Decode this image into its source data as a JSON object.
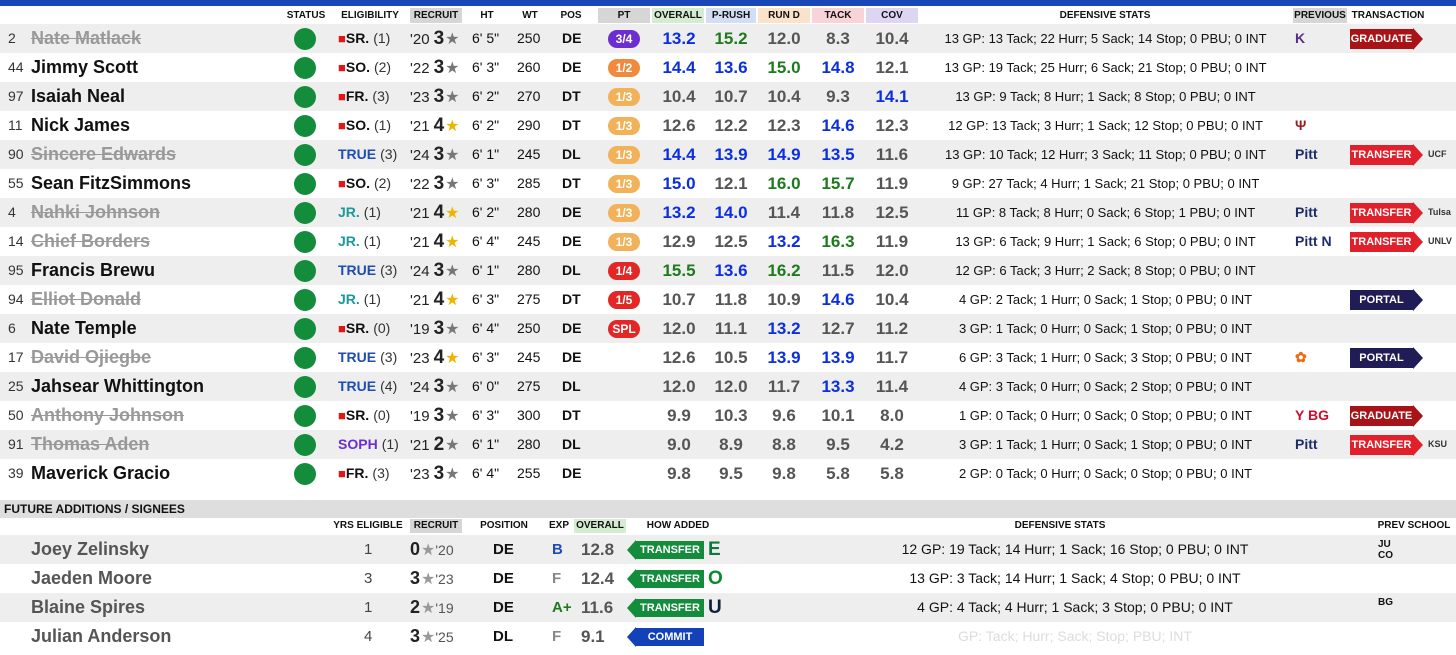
{
  "headers": {
    "status": "STATUS",
    "eligibility": "ELIGIBILITY",
    "recruit": "RECRUIT",
    "ht": "HT",
    "wt": "WT",
    "pos": "POS",
    "pt": "PT",
    "overall": "OVERALL",
    "prush": "P-RUSH",
    "rund": "RUN D",
    "tack": "TACK",
    "cov": "COV",
    "defstats": "DEFENSIVE STATS",
    "previous": "PREVIOUS",
    "transaction": "TRANSACTION"
  },
  "roster": [
    {
      "num": "2",
      "name": "Nate Matlack",
      "gone": true,
      "redshirt": true,
      "elig": "SR.",
      "eligcolor": "#111",
      "yrs": "(1)",
      "year": "'20",
      "stars": "3",
      "starcolor": "#777",
      "ht": "6' 5\"",
      "wt": "250",
      "pos": "DE",
      "pt": "3/4",
      "ptcolor": "#6b2fd1",
      "ovr": "13.2",
      "ovrc": "blu",
      "pr": "15.2",
      "prc": "grn",
      "rd": "12.0",
      "rdc": "gry",
      "tk": "8.3",
      "tkc": "gry",
      "cv": "10.4",
      "cvc": "gry",
      "stats": "13 GP: 13 Tack; 22 Hurr; 5 Sack; 14 Stop; 0 PBU; 0 INT",
      "prev": "K",
      "prevcolor": "#5a2d8a",
      "tx": "GRADUATE",
      "txc": "drk",
      "dest": ""
    },
    {
      "num": "44",
      "name": "Jimmy Scott",
      "gone": false,
      "redshirt": true,
      "elig": "SO.",
      "eligcolor": "#111",
      "yrs": "(2)",
      "year": "'22",
      "stars": "3",
      "starcolor": "#777",
      "ht": "6' 3\"",
      "wt": "260",
      "pos": "DE",
      "pt": "1/2",
      "ptcolor": "#f08a3c",
      "ovr": "14.4",
      "ovrc": "blu",
      "pr": "13.6",
      "prc": "blu",
      "rd": "15.0",
      "rdc": "grn",
      "tk": "14.8",
      "tkc": "blu",
      "cv": "12.1",
      "cvc": "gry",
      "stats": "13 GP: 19 Tack; 25 Hurr; 6 Sack; 21 Stop; 0 PBU; 0 INT",
      "prev": "",
      "prevcolor": "#000",
      "tx": "",
      "txc": "",
      "dest": ""
    },
    {
      "num": "97",
      "name": "Isaiah Neal",
      "gone": false,
      "redshirt": true,
      "elig": "FR.",
      "eligcolor": "#111",
      "yrs": "(3)",
      "year": "'23",
      "stars": "3",
      "starcolor": "#777",
      "ht": "6' 2\"",
      "wt": "270",
      "pos": "DT",
      "pt": "1/3",
      "ptcolor": "#f2b25a",
      "ovr": "10.4",
      "ovrc": "gry",
      "pr": "10.7",
      "prc": "gry",
      "rd": "10.4",
      "rdc": "gry",
      "tk": "9.3",
      "tkc": "gry",
      "cv": "14.1",
      "cvc": "blu",
      "stats": "13 GP: 9 Tack; 8 Hurr; 1 Sack; 8 Stop; 0 PBU; 0 INT",
      "prev": "",
      "prevcolor": "#000",
      "tx": "",
      "txc": "",
      "dest": ""
    },
    {
      "num": "11",
      "name": "Nick James",
      "gone": false,
      "redshirt": true,
      "elig": "SO.",
      "eligcolor": "#111",
      "yrs": "(1)",
      "year": "'21",
      "stars": "4",
      "starcolor": "#f0b400",
      "ht": "6' 2\"",
      "wt": "290",
      "pos": "DT",
      "pt": "1/3",
      "ptcolor": "#f2b25a",
      "ovr": "12.6",
      "ovrc": "gry",
      "pr": "12.2",
      "prc": "gry",
      "rd": "12.3",
      "rdc": "gry",
      "tk": "14.6",
      "tkc": "blu",
      "cv": "12.3",
      "cvc": "gry",
      "stats": "12 GP: 13 Tack; 3 Hurr; 1 Sack; 12 Stop; 0 PBU; 0 INT",
      "prev": "Ψ",
      "prevcolor": "#9b1b1e",
      "tx": "",
      "txc": "",
      "dest": ""
    },
    {
      "num": "90",
      "name": "Sincere Edwards",
      "gone": true,
      "redshirt": false,
      "elig": "TRUE",
      "eligcolor": "#1f4bb8",
      "yrs": "(3)",
      "year": "'24",
      "stars": "3",
      "starcolor": "#777",
      "ht": "6' 1\"",
      "wt": "245",
      "pos": "DL",
      "pt": "1/3",
      "ptcolor": "#f2b25a",
      "ovr": "14.4",
      "ovrc": "blu",
      "pr": "13.9",
      "prc": "blu",
      "rd": "14.9",
      "rdc": "blu",
      "tk": "13.5",
      "tkc": "blu",
      "cv": "11.6",
      "cvc": "gry",
      "stats": "13 GP: 10 Tack; 12 Hurr; 3 Sack; 11 Stop; 0 PBU; 0 INT",
      "prev": "Pitt",
      "prevcolor": "#1c2c6b",
      "tx": "TRANSFER",
      "txc": "red",
      "dest": "UCF"
    },
    {
      "num": "55",
      "name": "Sean FitzSimmons",
      "gone": false,
      "redshirt": true,
      "elig": "SO.",
      "eligcolor": "#111",
      "yrs": "(2)",
      "year": "'22",
      "stars": "3",
      "starcolor": "#777",
      "ht": "6' 3\"",
      "wt": "285",
      "pos": "DT",
      "pt": "1/3",
      "ptcolor": "#f2b25a",
      "ovr": "15.0",
      "ovrc": "blu",
      "pr": "12.1",
      "prc": "gry",
      "rd": "16.0",
      "rdc": "grn",
      "tk": "15.7",
      "tkc": "grn",
      "cv": "11.9",
      "cvc": "gry",
      "stats": "9 GP: 27 Tack; 4 Hurr; 1 Sack; 21 Stop; 0 PBU; 0 INT",
      "prev": "",
      "prevcolor": "#000",
      "tx": "",
      "txc": "",
      "dest": ""
    },
    {
      "num": "4",
      "name": "Nahki Johnson",
      "gone": true,
      "redshirt": false,
      "elig": "JR.",
      "eligcolor": "#1a9a9a",
      "yrs": "(1)",
      "year": "'21",
      "stars": "4",
      "starcolor": "#f0b400",
      "ht": "6' 2\"",
      "wt": "280",
      "pos": "DE",
      "pt": "1/3",
      "ptcolor": "#f2b25a",
      "ovr": "13.2",
      "ovrc": "blu",
      "pr": "14.0",
      "prc": "blu",
      "rd": "11.4",
      "rdc": "gry",
      "tk": "11.8",
      "tkc": "gry",
      "cv": "12.5",
      "cvc": "gry",
      "stats": "11 GP: 8 Tack; 8 Hurr; 0 Sack; 6 Stop; 1 PBU; 0 INT",
      "prev": "Pitt",
      "prevcolor": "#1c2c6b",
      "tx": "TRANSFER",
      "txc": "red",
      "dest": "Tulsa"
    },
    {
      "num": "14",
      "name": "Chief Borders",
      "gone": true,
      "redshirt": false,
      "elig": "JR.",
      "eligcolor": "#1a9a9a",
      "yrs": "(1)",
      "year": "'21",
      "stars": "4",
      "starcolor": "#f0b400",
      "ht": "6' 4\"",
      "wt": "245",
      "pos": "DE",
      "pt": "1/3",
      "ptcolor": "#f2b25a",
      "ovr": "12.9",
      "ovrc": "gry",
      "pr": "12.5",
      "prc": "gry",
      "rd": "13.2",
      "rdc": "blu",
      "tk": "16.3",
      "tkc": "grn",
      "cv": "11.9",
      "cvc": "gry",
      "stats": "13 GP: 6 Tack; 9 Hurr; 1 Sack; 6 Stop; 0 PBU; 0 INT",
      "prev": "Pitt N",
      "prevcolor": "#1c2c6b",
      "tx": "TRANSFER",
      "txc": "red",
      "dest": "UNLV"
    },
    {
      "num": "95",
      "name": "Francis Brewu",
      "gone": false,
      "redshirt": false,
      "elig": "TRUE",
      "eligcolor": "#1f4bb8",
      "yrs": "(3)",
      "year": "'24",
      "stars": "3",
      "starcolor": "#777",
      "ht": "6' 1\"",
      "wt": "280",
      "pos": "DL",
      "pt": "1/4",
      "ptcolor": "#e32626",
      "ovr": "15.5",
      "ovrc": "grn",
      "pr": "13.6",
      "prc": "blu",
      "rd": "16.2",
      "rdc": "grn",
      "tk": "11.5",
      "tkc": "gry",
      "cv": "12.0",
      "cvc": "gry",
      "stats": "12 GP: 6 Tack; 3 Hurr; 2 Sack; 8 Stop; 0 PBU; 0 INT",
      "prev": "",
      "prevcolor": "#000",
      "tx": "",
      "txc": "",
      "dest": ""
    },
    {
      "num": "94",
      "name": "Elliot Donald",
      "gone": true,
      "redshirt": false,
      "elig": "JR.",
      "eligcolor": "#1a9a9a",
      "yrs": "(1)",
      "year": "'21",
      "stars": "4",
      "starcolor": "#f0b400",
      "ht": "6' 3\"",
      "wt": "275",
      "pos": "DT",
      "pt": "1/5",
      "ptcolor": "#e32626",
      "ovr": "10.7",
      "ovrc": "gry",
      "pr": "11.8",
      "prc": "gry",
      "rd": "10.9",
      "rdc": "gry",
      "tk": "14.6",
      "tkc": "blu",
      "cv": "10.4",
      "cvc": "gry",
      "stats": "4 GP: 2 Tack; 1 Hurr; 0 Sack; 1 Stop; 0 PBU; 0 INT",
      "prev": "",
      "prevcolor": "#000",
      "tx": "PORTAL",
      "txc": "nav",
      "dest": ""
    },
    {
      "num": "6",
      "name": "Nate Temple",
      "gone": false,
      "redshirt": true,
      "elig": "SR.",
      "eligcolor": "#111",
      "yrs": "(0)",
      "year": "'19",
      "stars": "3",
      "starcolor": "#777",
      "ht": "6' 4\"",
      "wt": "250",
      "pos": "DE",
      "pt": "SPL",
      "ptcolor": "#e32626",
      "ovr": "12.0",
      "ovrc": "gry",
      "pr": "11.1",
      "prc": "gry",
      "rd": "13.2",
      "rdc": "blu",
      "tk": "12.7",
      "tkc": "gry",
      "cv": "11.2",
      "cvc": "gry",
      "stats": "3 GP: 1 Tack; 0 Hurr; 0 Sack; 1 Stop; 0 PBU; 0 INT",
      "prev": "",
      "prevcolor": "#000",
      "tx": "",
      "txc": "",
      "dest": ""
    },
    {
      "num": "17",
      "name": "David Ojiegbe",
      "gone": true,
      "redshirt": false,
      "elig": "TRUE",
      "eligcolor": "#1f4bb8",
      "yrs": "(3)",
      "year": "'23",
      "stars": "4",
      "starcolor": "#f0b400",
      "ht": "6' 3\"",
      "wt": "245",
      "pos": "DE",
      "pt": "",
      "ptcolor": "",
      "ovr": "12.6",
      "ovrc": "gry",
      "pr": "10.5",
      "prc": "gry",
      "rd": "13.9",
      "rdc": "blu",
      "tk": "13.9",
      "tkc": "blu",
      "cv": "11.7",
      "cvc": "gry",
      "stats": "6 GP: 3 Tack; 1 Hurr; 0 Sack; 3 Stop; 0 PBU; 0 INT",
      "prev": "✿",
      "prevcolor": "#f06a10",
      "tx": "PORTAL",
      "txc": "nav",
      "dest": ""
    },
    {
      "num": "25",
      "name": "Jahsear Whittington",
      "gone": false,
      "redshirt": false,
      "elig": "TRUE",
      "eligcolor": "#1f4bb8",
      "yrs": "(4)",
      "year": "'24",
      "stars": "3",
      "starcolor": "#777",
      "ht": "6' 0\"",
      "wt": "275",
      "pos": "DL",
      "pt": "",
      "ptcolor": "",
      "ovr": "12.0",
      "ovrc": "gry",
      "pr": "12.0",
      "prc": "gry",
      "rd": "11.7",
      "rdc": "gry",
      "tk": "13.3",
      "tkc": "blu",
      "cv": "11.4",
      "cvc": "gry",
      "stats": "4 GP: 3 Tack; 0 Hurr; 0 Sack; 2 Stop; 0 PBU; 0 INT",
      "prev": "",
      "prevcolor": "#000",
      "tx": "",
      "txc": "",
      "dest": ""
    },
    {
      "num": "50",
      "name": "Anthony Johnson",
      "gone": true,
      "redshirt": true,
      "elig": "SR.",
      "eligcolor": "#111",
      "yrs": "(0)",
      "year": "'19",
      "stars": "3",
      "starcolor": "#777",
      "ht": "6' 3\"",
      "wt": "300",
      "pos": "DT",
      "pt": "",
      "ptcolor": "",
      "ovr": "9.9",
      "ovrc": "gry",
      "pr": "10.3",
      "prc": "gry",
      "rd": "9.6",
      "rdc": "gry",
      "tk": "10.1",
      "tkc": "gry",
      "cv": "8.0",
      "cvc": "gry",
      "stats": "1 GP: 0 Tack; 0 Hurr; 0 Sack; 0 Stop; 0 PBU; 0 INT",
      "prev": "Y BG",
      "prevcolor": "#c8102e",
      "tx": "GRADUATE",
      "txc": "drk",
      "dest": ""
    },
    {
      "num": "91",
      "name": "Thomas Aden",
      "gone": true,
      "redshirt": false,
      "elig": "SOPH",
      "eligcolor": "#6b2fd1",
      "yrs": "(1)",
      "year": "'21",
      "stars": "2",
      "starcolor": "#777",
      "ht": "6' 1\"",
      "wt": "280",
      "pos": "DL",
      "pt": "",
      "ptcolor": "",
      "ovr": "9.0",
      "ovrc": "gry",
      "pr": "8.9",
      "prc": "gry",
      "rd": "8.8",
      "rdc": "gry",
      "tk": "9.5",
      "tkc": "gry",
      "cv": "4.2",
      "cvc": "gry",
      "stats": "3 GP: 1 Tack; 1 Hurr; 0 Sack; 1 Stop; 0 PBU; 0 INT",
      "prev": "Pitt",
      "prevcolor": "#1c2c6b",
      "tx": "TRANSFER",
      "txc": "red",
      "dest": "KSU"
    },
    {
      "num": "39",
      "name": "Maverick Gracio",
      "gone": false,
      "redshirt": true,
      "elig": "FR.",
      "eligcolor": "#111",
      "yrs": "(3)",
      "year": "'23",
      "stars": "3",
      "starcolor": "#777",
      "ht": "6' 4\"",
      "wt": "255",
      "pos": "DE",
      "pt": "",
      "ptcolor": "",
      "ovr": "9.8",
      "ovrc": "gry",
      "pr": "9.5",
      "prc": "gry",
      "rd": "9.8",
      "rdc": "gry",
      "tk": "5.8",
      "tkc": "gry",
      "cv": "5.8",
      "cvc": "gry",
      "stats": "2 GP: 0 Tack; 0 Hurr; 0 Sack; 0 Stop; 0 PBU; 0 INT",
      "prev": "",
      "prevcolor": "#000",
      "tx": "",
      "txc": "",
      "dest": ""
    }
  ],
  "future": {
    "title": "FUTURE ADDITIONS / SIGNEES",
    "headers": {
      "yrs": "YRS ELIGIBLE",
      "recruit": "RECRUIT",
      "position": "POSITION",
      "exp": "EXP",
      "overall": "OVERALL",
      "how": "HOW ADDED",
      "defstats": "DEFENSIVE STATS",
      "prev": "PREV SCHOOL"
    },
    "rows": [
      {
        "name": "Joey Zelinsky",
        "yrs": "1",
        "stars": "0",
        "year": "'20",
        "pos": "DE",
        "exp": "B",
        "expcolor": "#1f4bb8",
        "ovr": "12.8",
        "how": "TRANSFER",
        "howc": "grn",
        "school": "E",
        "schoolcolor": "#0b7a3a",
        "stats": "12 GP: 19 Tack; 14 Hurr; 1 Sack; 16 Stop; 0 PBU; 0 INT",
        "statscolor": "#111",
        "prev": "JU CO"
      },
      {
        "name": "Jaeden Moore",
        "yrs": "3",
        "stars": "3",
        "year": "'23",
        "pos": "DE",
        "exp": "F",
        "expcolor": "#888",
        "ovr": "12.4",
        "how": "TRANSFER",
        "howc": "grn",
        "school": "O",
        "schoolcolor": "#0a8a2c",
        "stats": "13 GP: 3 Tack; 14 Hurr; 1 Sack; 4 Stop; 0 PBU; 0 INT",
        "statscolor": "#111",
        "prev": ""
      },
      {
        "name": "Blaine Spires",
        "yrs": "1",
        "stars": "2",
        "year": "'19",
        "pos": "DE",
        "exp": "A+",
        "expcolor": "#1d7a1d",
        "ovr": "11.6",
        "how": "TRANSFER",
        "howc": "grn",
        "school": "U",
        "schoolcolor": "#0c2340",
        "stats": "4 GP: 4 Tack; 4 Hurr; 1 Sack; 3 Stop; 0 PBU; 0 INT",
        "statscolor": "#111",
        "prev": "BG"
      },
      {
        "name": "Julian Anderson",
        "yrs": "4",
        "stars": "3",
        "year": "'25",
        "pos": "DL",
        "exp": "F",
        "expcolor": "#888",
        "ovr": "9.1",
        "how": "COMMIT",
        "howc": "blu",
        "school": "",
        "schoolcolor": "#000",
        "stats": "GP:  Tack;  Hurr;  Sack;  Stop;  PBU;  INT",
        "statscolor": "#ddd",
        "prev": ""
      }
    ]
  }
}
